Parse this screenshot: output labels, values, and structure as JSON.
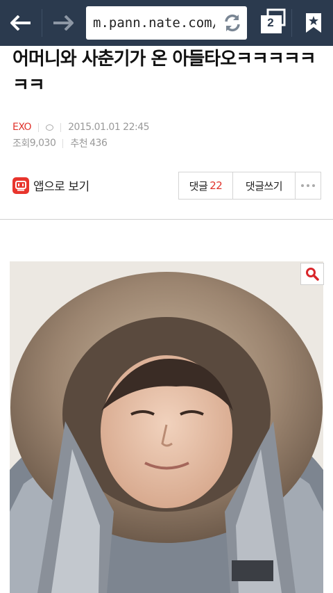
{
  "browser": {
    "url": "m.pann.nate.com/",
    "tab_count": "2",
    "icons": {
      "back": "back-arrow-icon",
      "forward": "forward-arrow-icon",
      "reload": "reload-icon",
      "tabs": "tabs-icon",
      "bookmark": "bookmark-star-icon"
    },
    "bar_color": "#2b3a4e"
  },
  "article": {
    "title": "어머니와 사춘기가 온 아들타오ㅋㅋㅋㅋㅋㅋㅋ",
    "category": "EXO",
    "datetime": "2015.01.01 22:45",
    "views_label": "조회",
    "views": "9,030",
    "recommend_label": "추천",
    "recommend": "436",
    "accent_color": "#e0322b"
  },
  "actions": {
    "app_view_label": "앱으로 보기",
    "comments_label": "댓글",
    "comments_count": "22",
    "write_comment_label": "댓글쓰기"
  }
}
